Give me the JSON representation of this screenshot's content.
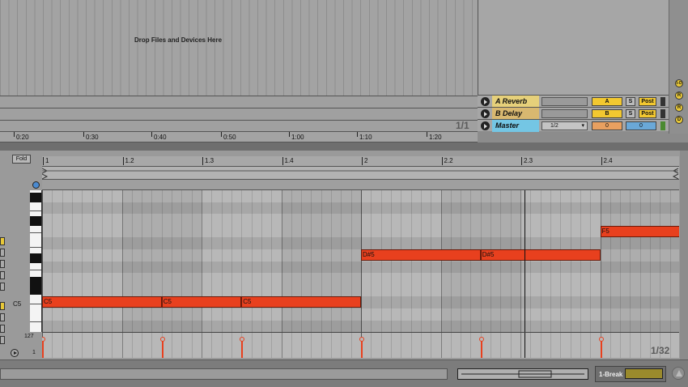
{
  "arrangement": {
    "drop_zone_text": "Drop Files and Devices Here",
    "time_ticks": [
      "0:20",
      "0:30",
      "0:40",
      "0:50",
      "1:00",
      "1:10",
      "1:20"
    ],
    "grid_fraction": "1/1"
  },
  "tracks": [
    {
      "name": "A Reverb",
      "send_label": "A",
      "solo_label": "S",
      "post_label": "Post",
      "color": "#e6d07a"
    },
    {
      "name": "B Delay",
      "send_label": "B",
      "solo_label": "S",
      "post_label": "Post",
      "color": "#d8b870"
    },
    {
      "name": "Master",
      "input_value": "1/2",
      "vol_left": "0",
      "vol_right": "0",
      "color": "#74c6e4"
    }
  ],
  "right_toolbar": {
    "buttons": [
      "I-O",
      "R",
      "R",
      "D"
    ]
  },
  "clip_view": {
    "fold_label": "Fold",
    "bar_ticks": [
      "1",
      "1.2",
      "1.3",
      "1.4",
      "2",
      "2.2",
      "2.3",
      "2.4"
    ],
    "key_label": "C5",
    "velocity_max": "127",
    "velocity_min": "1",
    "grid_fraction": "1/32",
    "notes": [
      {
        "label": "C5",
        "pitch": "C5",
        "start_beat": 0,
        "length_beats": 1.5
      },
      {
        "label": "C5",
        "pitch": "C5",
        "start_beat": 1.5,
        "length_beats": 1.0
      },
      {
        "label": "C5",
        "pitch": "C5",
        "start_beat": 2.5,
        "length_beats": 1.5
      },
      {
        "label": "D#5",
        "pitch": "D#5",
        "start_beat": 4.0,
        "length_beats": 1.5
      },
      {
        "label": "D#5",
        "pitch": "D#5",
        "start_beat": 5.5,
        "length_beats": 1.5
      },
      {
        "label": "F5",
        "pitch": "F5",
        "start_beat": 7.0,
        "length_beats": 1.0
      }
    ],
    "playhead_beat": 6.05,
    "accent_color": "#e8401e"
  },
  "status": {
    "break_label": "1-Break"
  }
}
